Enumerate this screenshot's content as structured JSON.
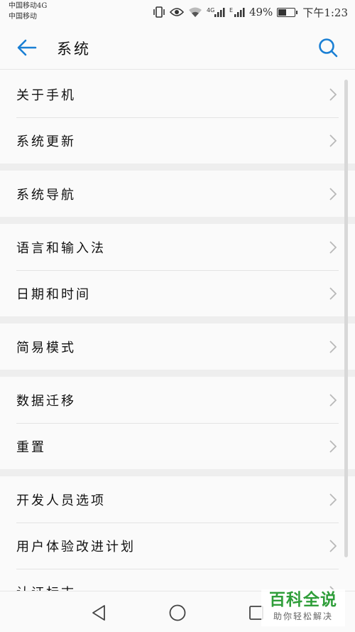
{
  "status_bar": {
    "carrier_1": "中国移动4G",
    "carrier_2": "中国移动",
    "net_1": "4G",
    "net_2": "E",
    "battery": "49%",
    "time": "下午1:23"
  },
  "header": {
    "title": "系统",
    "back_icon": "arrow-left-icon",
    "search_icon": "search-icon",
    "accent_color": "#1a7fd4"
  },
  "groups": [
    {
      "items": [
        {
          "label": "关于手机"
        },
        {
          "label": "系统更新"
        }
      ]
    },
    {
      "items": [
        {
          "label": "系统导航"
        }
      ]
    },
    {
      "items": [
        {
          "label": "语言和输入法"
        },
        {
          "label": "日期和时间"
        }
      ]
    },
    {
      "items": [
        {
          "label": "简易模式"
        }
      ]
    },
    {
      "items": [
        {
          "label": "数据迁移"
        },
        {
          "label": "重置"
        }
      ]
    },
    {
      "items": [
        {
          "label": "开发人员选项"
        },
        {
          "label": "用户体验改进计划"
        },
        {
          "label": "认证标志"
        }
      ]
    }
  ],
  "nav_bar": {
    "back_icon": "triangle-back-icon",
    "home_icon": "circle-home-icon",
    "recent_icon": "square-recent-icon"
  },
  "watermark": {
    "title": "百科全说",
    "subtitle": "助你轻松解决"
  }
}
